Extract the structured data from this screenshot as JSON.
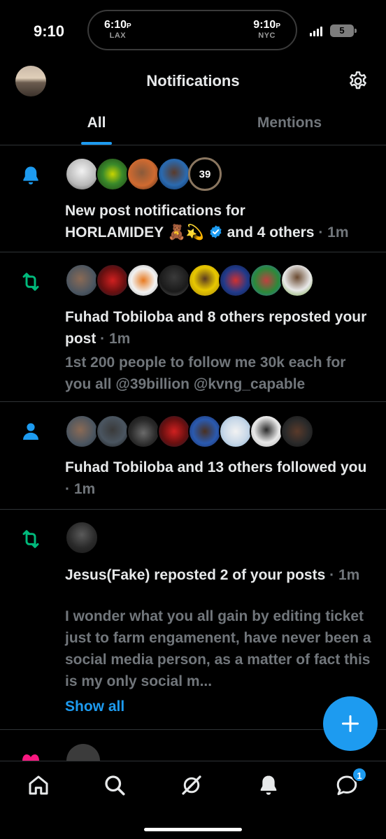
{
  "status_bar": {
    "time": "9:10",
    "left_clock": {
      "time": "6:10",
      "ampm": "P",
      "city": "LAX"
    },
    "right_clock": {
      "time": "9:10",
      "ampm": "P",
      "city": "NYC"
    },
    "battery": "5"
  },
  "header": {
    "title": "Notifications",
    "settings_icon": "gear-icon"
  },
  "tabs": [
    {
      "label": "All",
      "active": true
    },
    {
      "label": "Mentions",
      "active": false
    }
  ],
  "notifications": [
    {
      "type": "new-post",
      "icon": "bell-icon",
      "avatar_count_badge": "39",
      "text_line1": "New post notifications for",
      "text_line2": "HORLAMIDEY 🧸💫",
      "text_line2_suffix": "and 4 others",
      "time": "· 1m"
    },
    {
      "type": "repost",
      "icon": "repost-icon",
      "text": "Fuhad Tobiloba and 8 others reposted your post",
      "time": "· 1m",
      "post_preview": "1st 200 people to follow me 30k each for you all @39billion @kvng_capable"
    },
    {
      "type": "follow",
      "icon": "person-icon",
      "text": "Fuhad Tobiloba and 13 others followed you",
      "time": "· 1m"
    },
    {
      "type": "repost",
      "icon": "repost-icon",
      "text": "Jesus(Fake) reposted 2 of your posts",
      "time": "· 1m",
      "post_preview": "I wonder what you all gain by editing ticket just to farm engamenent, have never been a social media person, as a matter of fact this is my only social m...",
      "show_all": "Show all"
    }
  ],
  "bottom_nav": {
    "items": [
      "home-icon",
      "search-icon",
      "grok-icon",
      "notifications-bell-icon",
      "messages-icon"
    ],
    "messages_badge": "1"
  },
  "colors": {
    "accent": "#1d9bf0",
    "repost": "#00ba7c",
    "muted": "#71767b",
    "background": "#000000"
  }
}
